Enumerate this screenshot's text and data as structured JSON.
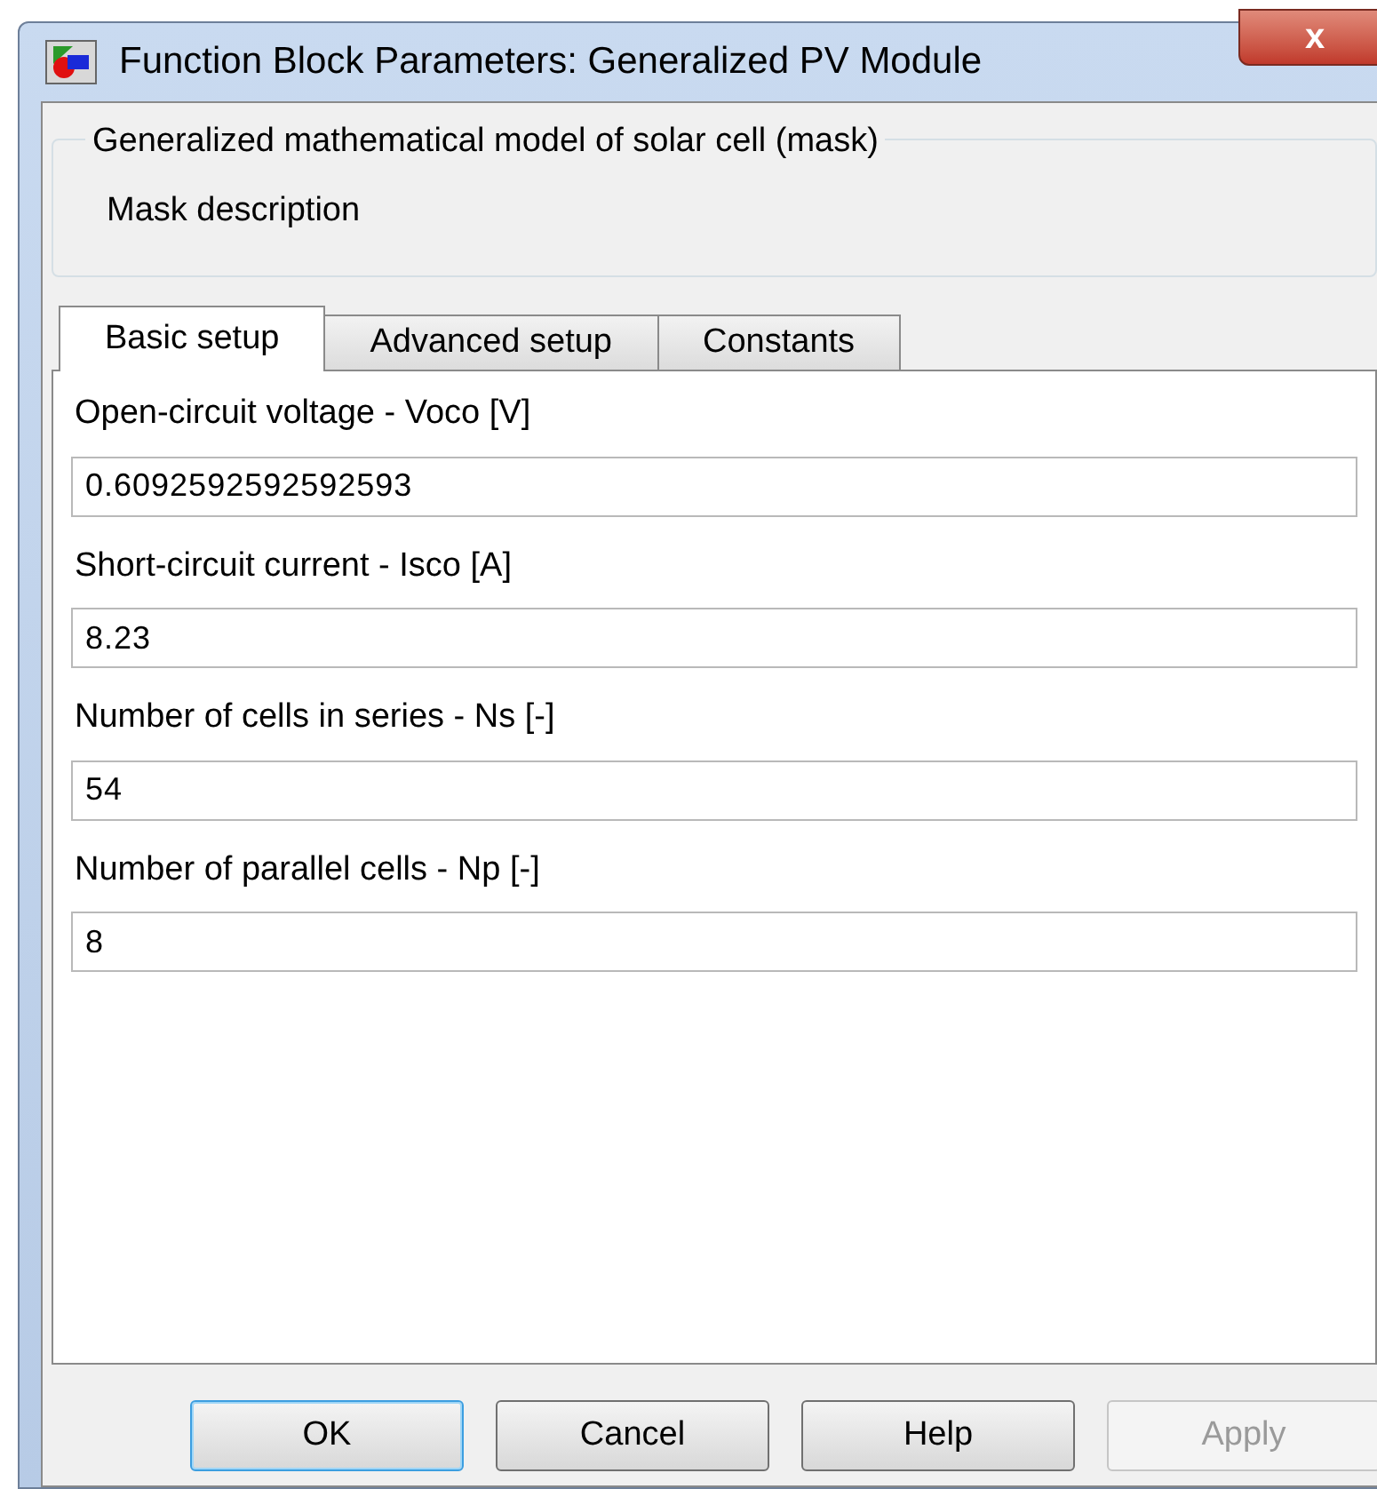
{
  "window": {
    "title": "Function Block Parameters: Generalized PV Module",
    "close": "x"
  },
  "mask": {
    "title": "Generalized mathematical model of solar cell (mask)",
    "description": "Mask description"
  },
  "tabs": [
    {
      "label": "Basic setup",
      "selected": true
    },
    {
      "label": "Advanced setup",
      "selected": false
    },
    {
      "label": "Constants",
      "selected": false
    }
  ],
  "parameters": [
    {
      "label": "Open-circuit voltage - Voco [V]",
      "value": "0.6092592592592593"
    },
    {
      "label": "Short-circuit current - Isco [A]",
      "value": "8.23"
    },
    {
      "label": "Number of cells in series - Ns [-]",
      "value": "54"
    },
    {
      "label": "Number of parallel cells - Np [-]",
      "value": "8"
    }
  ],
  "buttons": [
    {
      "label": "OK",
      "default": true,
      "disabled": false
    },
    {
      "label": "Cancel",
      "default": false,
      "disabled": false
    },
    {
      "label": "Help",
      "default": false,
      "disabled": false
    },
    {
      "label": "Apply",
      "default": false,
      "disabled": true
    }
  ]
}
